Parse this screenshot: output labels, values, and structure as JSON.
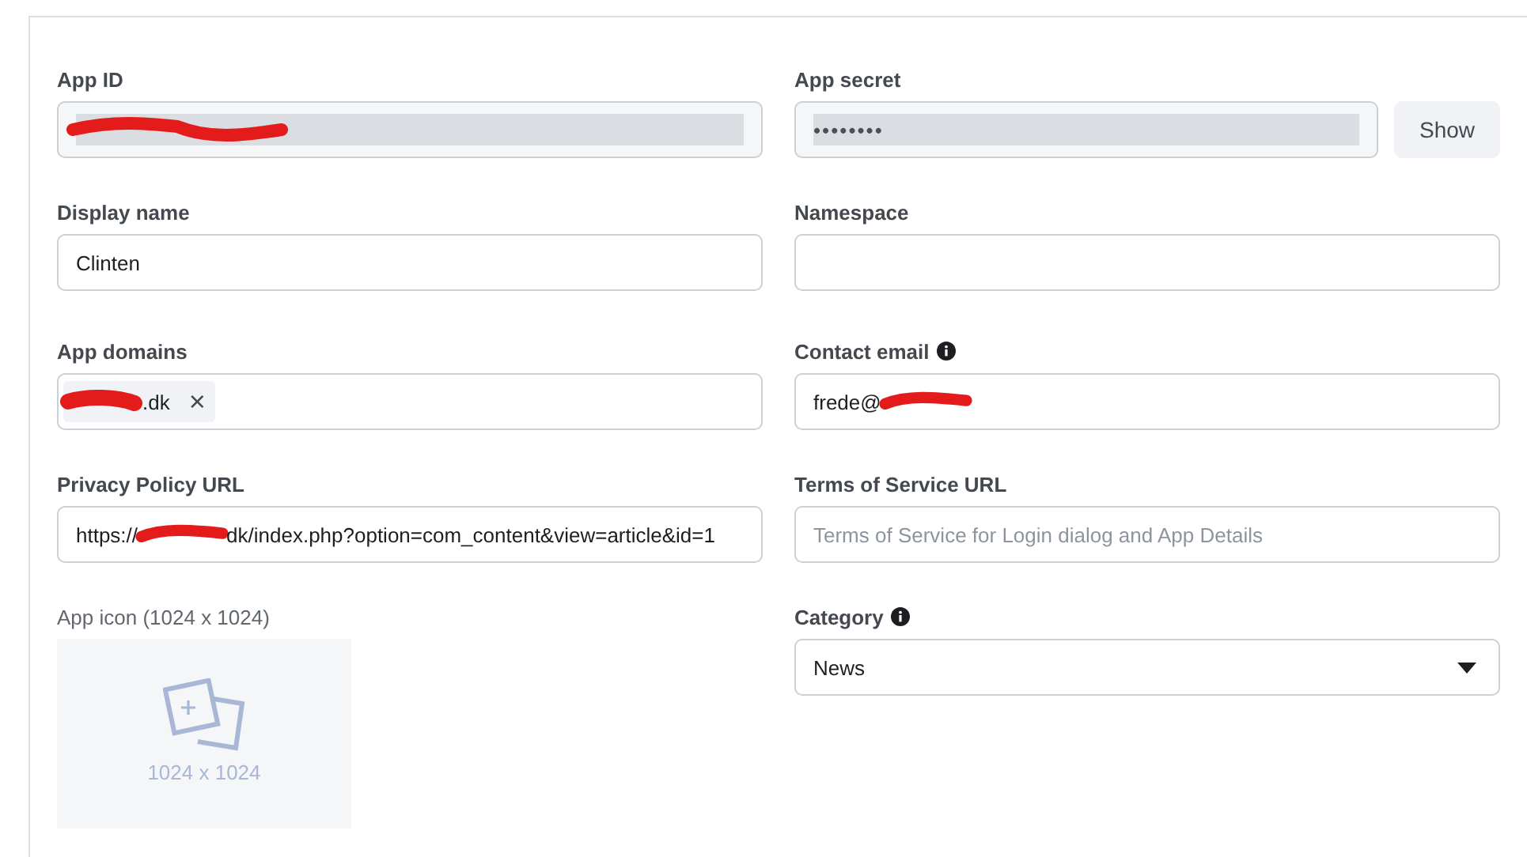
{
  "fields": [
    {
      "label": "App ID",
      "kind": "masked",
      "segments": [
        {
          "kind": "redaction"
        }
      ]
    },
    {
      "label": "App secret",
      "kind": "secret",
      "segments": [
        {
          "kind": "text",
          "text": "••••••••"
        }
      ],
      "button": "Show"
    },
    {
      "label": "Display name",
      "kind": "text",
      "segments": [
        {
          "kind": "text",
          "text": "Clinten"
        }
      ]
    },
    {
      "label": "Namespace",
      "kind": "text"
    },
    {
      "label": "App domains",
      "kind": "tags",
      "segments": [
        {
          "kind": "redaction"
        },
        {
          "kind": "text",
          "text": ".dk"
        }
      ],
      "remove": "×"
    },
    {
      "label": "Contact email",
      "kind": "text",
      "info": true,
      "segments": [
        {
          "kind": "text",
          "text": "frede@"
        },
        {
          "kind": "redaction"
        }
      ]
    },
    {
      "label": "Privacy Policy URL",
      "kind": "text",
      "segments": [
        {
          "kind": "text",
          "text": "https://"
        },
        {
          "kind": "redaction"
        },
        {
          "kind": "text",
          "text": "dk/index.php?option=com_content&view=article&id=1"
        }
      ]
    },
    {
      "label": "Terms of Service URL",
      "kind": "text",
      "placeholder": "Terms of Service for Login dialog and App Details"
    },
    {
      "label": "App icon (1024 x 1024)",
      "kind": "image",
      "caption": "1024 x 1024"
    },
    {
      "label": "Category",
      "kind": "select",
      "info": true,
      "segments": [
        {
          "kind": "text",
          "text": "News"
        }
      ]
    }
  ]
}
